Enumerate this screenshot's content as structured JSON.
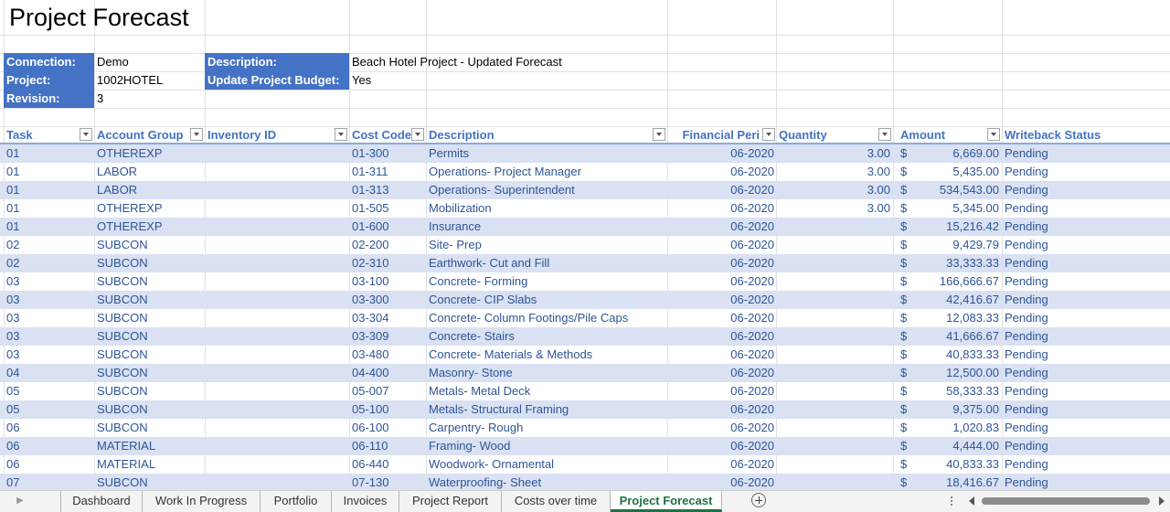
{
  "title": "Project Forecast",
  "info": {
    "connection_label": "Connection:",
    "connection_value": "Demo",
    "project_label": "Project:",
    "project_value": "1002HOTEL",
    "revision_label": "Revision:",
    "revision_value": "3",
    "description_label": "Description:",
    "description_value": "Beach Hotel Project - Updated Forecast",
    "update_label": "Update Project Budget:",
    "update_value": "Yes"
  },
  "columns": [
    "Task",
    "Account Group",
    "Inventory ID",
    "Cost Code",
    "Description",
    "Financial Peri",
    "Quantity",
    "Amount",
    "Writeback Status"
  ],
  "currency_symbol": "$",
  "rows": [
    {
      "task": "01",
      "group": "OTHEREXP",
      "inventory": "",
      "code": "01-300",
      "desc": "Permits",
      "period": "06-2020",
      "qty": "3.00",
      "amount": "6,669.00",
      "status": "Pending"
    },
    {
      "task": "01",
      "group": "LABOR",
      "inventory": "",
      "code": "01-311",
      "desc": "Operations- Project Manager",
      "period": "06-2020",
      "qty": "3.00",
      "amount": "5,435.00",
      "status": "Pending"
    },
    {
      "task": "01",
      "group": "LABOR",
      "inventory": "",
      "code": "01-313",
      "desc": "Operations- Superintendent",
      "period": "06-2020",
      "qty": "3.00",
      "amount": "534,543.00",
      "status": "Pending"
    },
    {
      "task": "01",
      "group": "OTHEREXP",
      "inventory": "",
      "code": "01-505",
      "desc": "Mobilization",
      "period": "06-2020",
      "qty": "3.00",
      "amount": "5,345.00",
      "status": "Pending"
    },
    {
      "task": "01",
      "group": "OTHEREXP",
      "inventory": "",
      "code": "01-600",
      "desc": "Insurance",
      "period": "06-2020",
      "qty": "",
      "amount": "15,216.42",
      "status": "Pending"
    },
    {
      "task": "02",
      "group": "SUBCON",
      "inventory": "",
      "code": "02-200",
      "desc": "Site- Prep",
      "period": "06-2020",
      "qty": "",
      "amount": "9,429.79",
      "status": "Pending"
    },
    {
      "task": "02",
      "group": "SUBCON",
      "inventory": "",
      "code": "02-310",
      "desc": "Earthwork- Cut and Fill",
      "period": "06-2020",
      "qty": "",
      "amount": "33,333.33",
      "status": "Pending"
    },
    {
      "task": "03",
      "group": "SUBCON",
      "inventory": "",
      "code": "03-100",
      "desc": "Concrete- Forming",
      "period": "06-2020",
      "qty": "",
      "amount": "166,666.67",
      "status": "Pending"
    },
    {
      "task": "03",
      "group": "SUBCON",
      "inventory": "",
      "code": "03-300",
      "desc": "Concrete- CIP Slabs",
      "period": "06-2020",
      "qty": "",
      "amount": "42,416.67",
      "status": "Pending"
    },
    {
      "task": "03",
      "group": "SUBCON",
      "inventory": "",
      "code": "03-304",
      "desc": "Concrete- Column Footings/Pile Caps",
      "period": "06-2020",
      "qty": "",
      "amount": "12,083.33",
      "status": "Pending"
    },
    {
      "task": "03",
      "group": "SUBCON",
      "inventory": "",
      "code": "03-309",
      "desc": "Concrete- Stairs",
      "period": "06-2020",
      "qty": "",
      "amount": "41,666.67",
      "status": "Pending"
    },
    {
      "task": "03",
      "group": "SUBCON",
      "inventory": "",
      "code": "03-480",
      "desc": "Concrete- Materials & Methods",
      "period": "06-2020",
      "qty": "",
      "amount": "40,833.33",
      "status": "Pending"
    },
    {
      "task": "04",
      "group": "SUBCON",
      "inventory": "",
      "code": "04-400",
      "desc": "Masonry- Stone",
      "period": "06-2020",
      "qty": "",
      "amount": "12,500.00",
      "status": "Pending"
    },
    {
      "task": "05",
      "group": "SUBCON",
      "inventory": "",
      "code": "05-007",
      "desc": "Metals- Metal Deck",
      "period": "06-2020",
      "qty": "",
      "amount": "58,333.33",
      "status": "Pending"
    },
    {
      "task": "05",
      "group": "SUBCON",
      "inventory": "",
      "code": "05-100",
      "desc": "Metals- Structural Framing",
      "period": "06-2020",
      "qty": "",
      "amount": "9,375.00",
      "status": "Pending"
    },
    {
      "task": "06",
      "group": "SUBCON",
      "inventory": "",
      "code": "06-100",
      "desc": "Carpentry- Rough",
      "period": "06-2020",
      "qty": "",
      "amount": "1,020.83",
      "status": "Pending"
    },
    {
      "task": "06",
      "group": "MATERIAL",
      "inventory": "",
      "code": "06-110",
      "desc": "Framing- Wood",
      "period": "06-2020",
      "qty": "",
      "amount": "4,444.00",
      "status": "Pending"
    },
    {
      "task": "06",
      "group": "MATERIAL",
      "inventory": "",
      "code": "06-440",
      "desc": "Woodwork- Ornamental",
      "period": "06-2020",
      "qty": "",
      "amount": "40,833.33",
      "status": "Pending"
    },
    {
      "task": "07",
      "group": "SUBCON",
      "inventory": "",
      "code": "07-130",
      "desc": "Waterproofing- Sheet",
      "period": "06-2020",
      "qty": "",
      "amount": "18,416.67",
      "status": "Pending"
    }
  ],
  "tabs": [
    {
      "label": "Dashboard",
      "active": false
    },
    {
      "label": "Work In Progress",
      "active": false
    },
    {
      "label": "Portfolio",
      "active": false
    },
    {
      "label": "Invoices",
      "active": false
    },
    {
      "label": "Project Report",
      "active": false
    },
    {
      "label": "Costs over time",
      "active": false
    },
    {
      "label": "Project Forecast",
      "active": true
    }
  ]
}
